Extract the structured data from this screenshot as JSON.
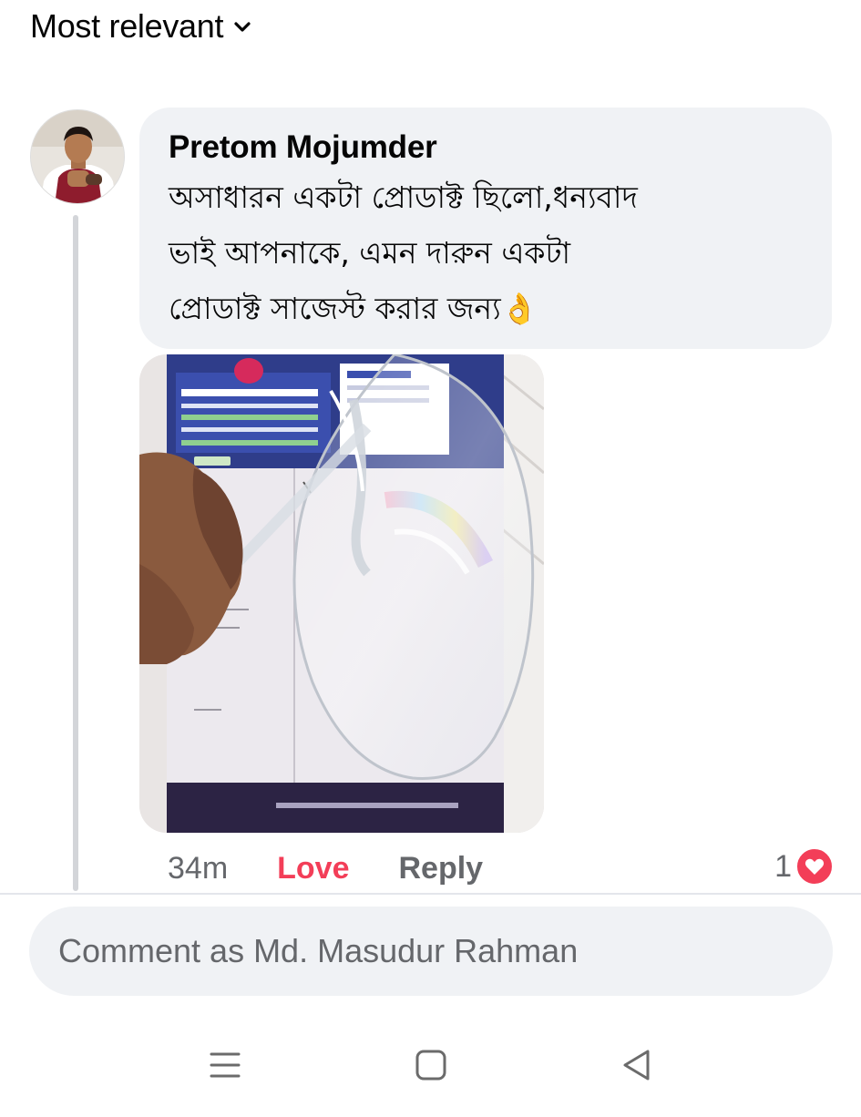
{
  "sort": {
    "label": "Most relevant",
    "icon": "chevron-down-icon"
  },
  "comment": {
    "author": "Pretom Mojumder",
    "text_lines": [
      "অসাধারন একটা প্রোডাক্ট ছিলো,ধন্যবাদ",
      "ভাই আপনাকে, এমন দারুন একটা",
      "প্রোডাক্ট সাজেস্ট করার জন্য👌"
    ],
    "time": "34m",
    "love_label": "Love",
    "reply_label": "Reply",
    "reaction_count": "1",
    "reaction_icon": "heart-icon"
  },
  "comment_input": {
    "placeholder": "Comment as Md. Masudur Rahman"
  },
  "nav": {
    "recent_icon": "recent-apps-icon",
    "home_icon": "home-icon",
    "back_icon": "back-icon"
  },
  "colors": {
    "love": "#f33e58",
    "bubble": "#f0f2f5",
    "muted": "#65676b"
  }
}
